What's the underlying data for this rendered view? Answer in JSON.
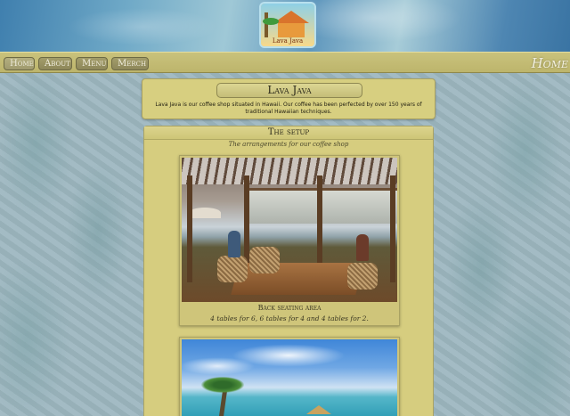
{
  "header": {
    "logo_text": "Lava Java"
  },
  "nav": {
    "items": [
      {
        "label": "Home",
        "active": true
      },
      {
        "label": "About",
        "active": false
      },
      {
        "label": "Menu",
        "active": false
      },
      {
        "label": "Merch",
        "active": false
      }
    ],
    "current_page": "Home"
  },
  "intro": {
    "title": "Lava Java",
    "text": "Lava Java is our coffee shop situated in Hawaii. Our coffee has been perfected by over 150 years of traditional Hawaiian techniques."
  },
  "setup": {
    "title": "The setup",
    "subtitle": "The arrangements for our coffee shop",
    "photos": [
      {
        "title": "Back seating area",
        "caption": "4 tables for 6, 6 tables for 4 and 4 tables for 2."
      },
      {
        "title": "",
        "caption": ""
      }
    ]
  },
  "colors": {
    "panel": "#d6cd7f",
    "navbar": "#c9c27c",
    "nav_button": "#8d875a"
  }
}
